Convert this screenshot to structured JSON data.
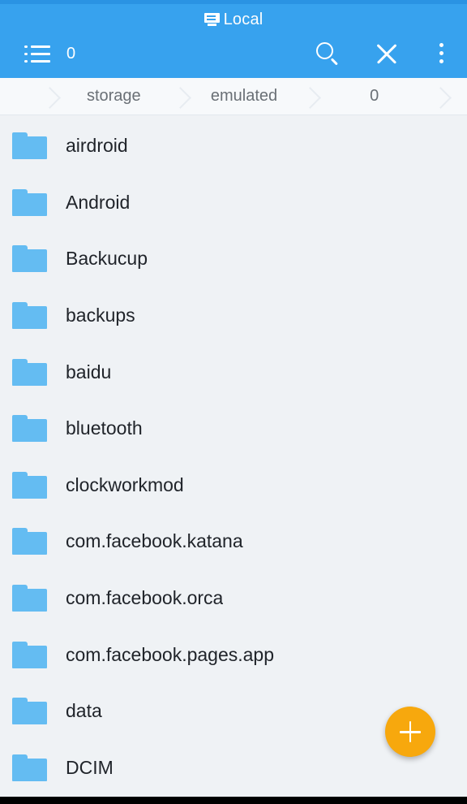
{
  "window": {
    "title": "Local",
    "title_icon": "device-screen-icon"
  },
  "appbar": {
    "list_icon": "list-view-icon",
    "selection_count": "0",
    "signal_icon": "signal-triangle-icon",
    "search_icon": "search-icon",
    "close_icon": "close-icon",
    "overflow_icon": "more-vertical-icon",
    "background_color": "#37a2ee"
  },
  "breadcrumb": {
    "name": "path-breadcrumb",
    "segments": [
      {
        "label": "storage"
      },
      {
        "label": "emulated"
      },
      {
        "label": "0"
      }
    ]
  },
  "filelist": {
    "items": [
      {
        "name": "airdroid",
        "icon": "folder-icon"
      },
      {
        "name": "Android",
        "icon": "folder-icon"
      },
      {
        "name": "Backucup",
        "icon": "folder-icon"
      },
      {
        "name": "backups",
        "icon": "folder-icon"
      },
      {
        "name": "baidu",
        "icon": "folder-icon"
      },
      {
        "name": "bluetooth",
        "icon": "folder-icon"
      },
      {
        "name": "clockworkmod",
        "icon": "folder-icon"
      },
      {
        "name": "com.facebook.katana",
        "icon": "folder-icon"
      },
      {
        "name": "com.facebook.orca",
        "icon": "folder-icon"
      },
      {
        "name": "com.facebook.pages.app",
        "icon": "folder-icon"
      },
      {
        "name": "data",
        "icon": "folder-icon"
      },
      {
        "name": "DCIM",
        "icon": "folder-icon"
      }
    ]
  },
  "fab": {
    "name": "add-button",
    "icon": "plus-icon",
    "color": "#f7a80d"
  },
  "colors": {
    "accent": "#37a2ee",
    "folder": "#64bcf2",
    "background": "#eff2f5",
    "fab": "#f7a80d"
  }
}
